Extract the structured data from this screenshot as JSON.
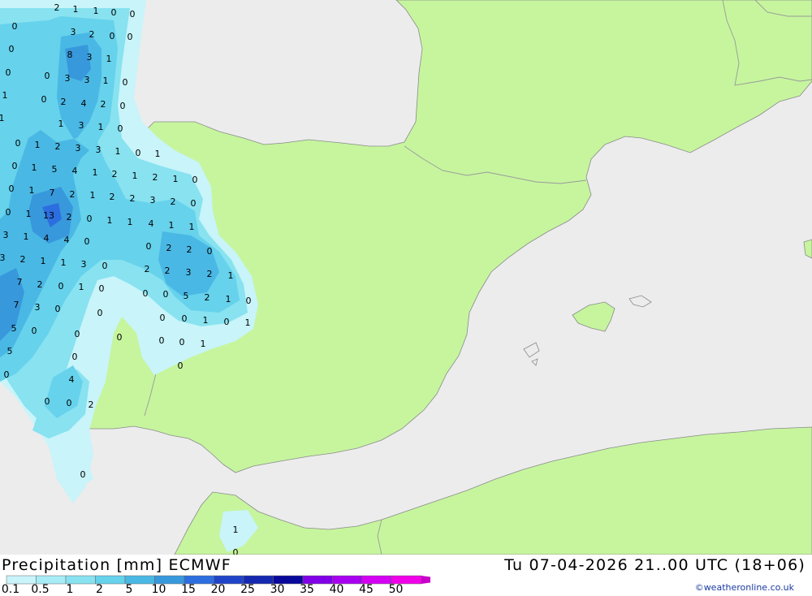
{
  "title": "Precipitation [mm] ECMWF",
  "datetime": "Tu 07-04-2026 21..00 UTC (18+06)",
  "credit": "©weatheronline.co.uk",
  "colors": {
    "sea": "#ececec",
    "land": "#c6f59e",
    "border": "#9a9a9a"
  },
  "legend": {
    "labels": [
      "0.1",
      "0.5",
      "1",
      "2",
      "5",
      "10",
      "15",
      "20",
      "25",
      "30",
      "35",
      "40",
      "45",
      "50"
    ],
    "colors": [
      "#c8f4fa",
      "#a8ecf6",
      "#88e2f0",
      "#66d2ec",
      "#4ab8e4",
      "#3898dc",
      "#2c6ee0",
      "#2044c8",
      "#1428b0",
      "#08089a",
      "#8000e8",
      "#a800f0",
      "#d400f4",
      "#f000e8",
      "#c800c8"
    ]
  },
  "values": [
    {
      "t": "2"
    },
    {
      "t": "1"
    },
    {
      "t": "1"
    },
    {
      "t": "0"
    },
    {
      "t": "0"
    },
    {
      "t": "0"
    },
    {
      "t": "3"
    },
    {
      "t": "2"
    },
    {
      "t": "0"
    },
    {
      "t": "0"
    },
    {
      "t": "0"
    },
    {
      "t": "8"
    },
    {
      "t": "3"
    },
    {
      "t": "1"
    },
    {
      "t": "0"
    },
    {
      "t": "0"
    },
    {
      "t": "3"
    },
    {
      "t": "3"
    },
    {
      "t": "1"
    },
    {
      "t": "0"
    },
    {
      "t": "1"
    },
    {
      "t": "0"
    },
    {
      "t": "2"
    },
    {
      "t": "4"
    },
    {
      "t": "2"
    },
    {
      "t": "0"
    },
    {
      "t": "1"
    },
    {
      "t": "1"
    },
    {
      "t": "3"
    },
    {
      "t": "1"
    },
    {
      "t": "0"
    },
    {
      "t": "0"
    },
    {
      "t": "1"
    },
    {
      "t": "2"
    },
    {
      "t": "3"
    },
    {
      "t": "3"
    },
    {
      "t": "1"
    },
    {
      "t": "0"
    },
    {
      "t": "1"
    },
    {
      "t": "0"
    },
    {
      "t": "1"
    },
    {
      "t": "5"
    },
    {
      "t": "4"
    },
    {
      "t": "1"
    },
    {
      "t": "2"
    },
    {
      "t": "1"
    },
    {
      "t": "2"
    },
    {
      "t": "1"
    },
    {
      "t": "0"
    },
    {
      "t": "0"
    },
    {
      "t": "1"
    },
    {
      "t": "7"
    },
    {
      "t": "2"
    },
    {
      "t": "1"
    },
    {
      "t": "2"
    },
    {
      "t": "2"
    },
    {
      "t": "3"
    },
    {
      "t": "2"
    },
    {
      "t": "0"
    },
    {
      "t": "0"
    },
    {
      "t": "1"
    },
    {
      "t": "13"
    },
    {
      "t": "2"
    },
    {
      "t": "0"
    },
    {
      "t": "1"
    },
    {
      "t": "1"
    },
    {
      "t": "4"
    },
    {
      "t": "1"
    },
    {
      "t": "1"
    },
    {
      "t": "3"
    },
    {
      "t": "1"
    },
    {
      "t": "4"
    },
    {
      "t": "4"
    },
    {
      "t": "0"
    },
    {
      "t": "0"
    },
    {
      "t": "2"
    },
    {
      "t": "2"
    },
    {
      "t": "0"
    },
    {
      "t": "3"
    },
    {
      "t": "2"
    },
    {
      "t": "1"
    },
    {
      "t": "1"
    },
    {
      "t": "3"
    },
    {
      "t": "0"
    },
    {
      "t": "2"
    },
    {
      "t": "2"
    },
    {
      "t": "3"
    },
    {
      "t": "2"
    },
    {
      "t": "1"
    },
    {
      "t": "7"
    },
    {
      "t": "2"
    },
    {
      "t": "0"
    },
    {
      "t": "1"
    },
    {
      "t": "0"
    },
    {
      "t": "0"
    },
    {
      "t": "0"
    },
    {
      "t": "5"
    },
    {
      "t": "2"
    },
    {
      "t": "1"
    },
    {
      "t": "0"
    },
    {
      "t": "7"
    },
    {
      "t": "3"
    },
    {
      "t": "0"
    },
    {
      "t": "0"
    },
    {
      "t": "0"
    },
    {
      "t": "0"
    },
    {
      "t": "1"
    },
    {
      "t": "0"
    },
    {
      "t": "1"
    },
    {
      "t": "5"
    },
    {
      "t": "0"
    },
    {
      "t": "0"
    },
    {
      "t": "0"
    },
    {
      "t": "0"
    },
    {
      "t": "0"
    },
    {
      "t": "1"
    },
    {
      "t": "5"
    },
    {
      "t": "0"
    },
    {
      "t": "0"
    },
    {
      "t": "0"
    },
    {
      "t": "4"
    },
    {
      "t": "0"
    },
    {
      "t": "0"
    },
    {
      "t": "2"
    },
    {
      "t": "0"
    },
    {
      "t": "1"
    },
    {
      "t": "0"
    }
  ]
}
